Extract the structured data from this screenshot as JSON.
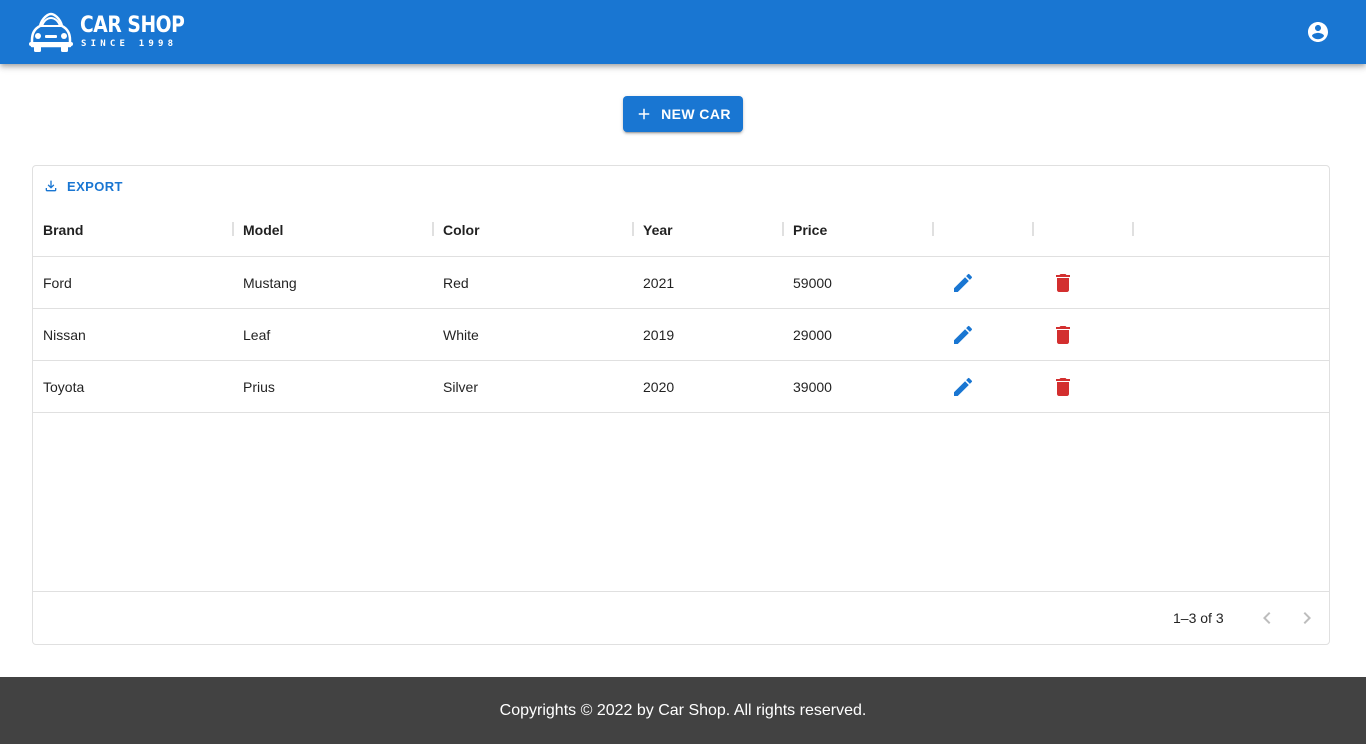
{
  "app": {
    "logo_title": "CAR SHOP",
    "logo_subtitle": "SINCE 1998",
    "account_icon": "account-circle-icon",
    "brand_color": "#1976d2"
  },
  "toolbar": {
    "new_car_label": "NEW CAR",
    "add_icon": "plus-icon"
  },
  "grid": {
    "export_label": "EXPORT",
    "export_icon": "download-icon",
    "columns": [
      "Brand",
      "Model",
      "Color",
      "Year",
      "Price",
      "",
      ""
    ],
    "rows": [
      {
        "brand": "Ford",
        "model": "Mustang",
        "color": "Red",
        "year": "2021",
        "price": "59000"
      },
      {
        "brand": "Nissan",
        "model": "Leaf",
        "color": "White",
        "year": "2019",
        "price": "29000"
      },
      {
        "brand": "Toyota",
        "model": "Prius",
        "color": "Silver",
        "year": "2020",
        "price": "39000"
      }
    ],
    "edit_icon": "pencil-icon",
    "delete_icon": "trash-icon",
    "edit_color": "#1976d2",
    "delete_color": "#d32f2f",
    "pagination": {
      "range_text": "1–3 of 3"
    }
  },
  "footer": {
    "copyright": "Copyrights © 2022 by Car Shop. All rights reserved."
  }
}
